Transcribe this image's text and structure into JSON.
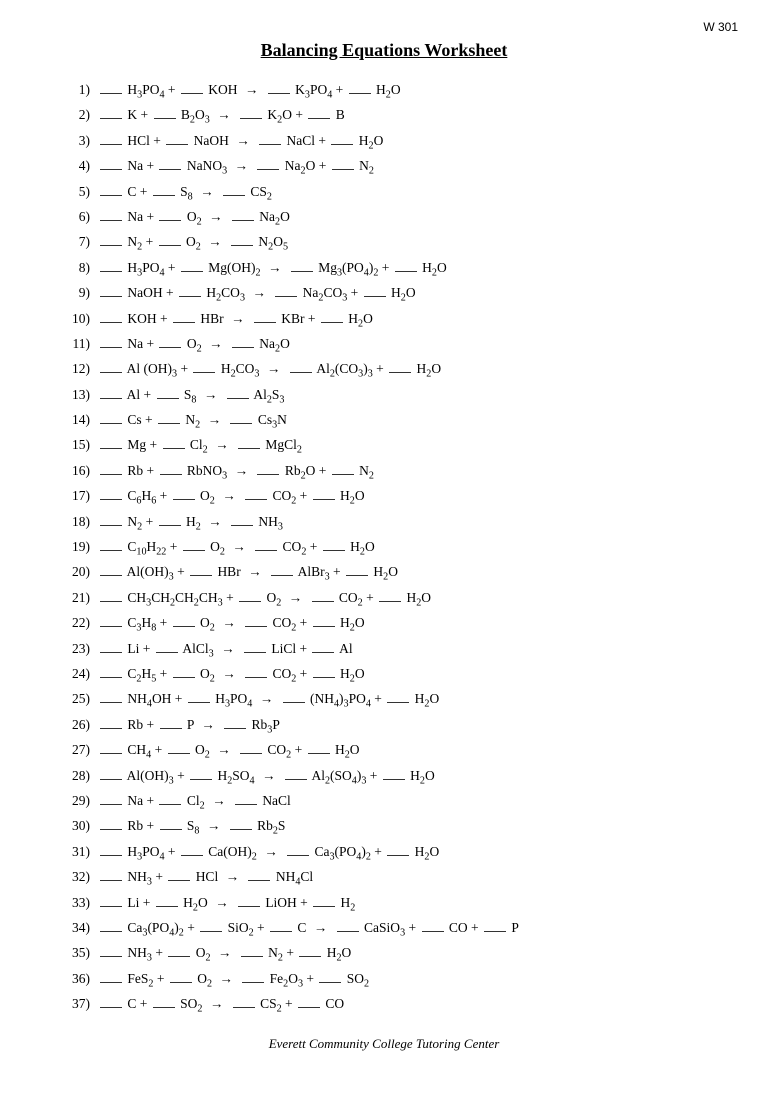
{
  "page": {
    "number": "W 301",
    "title": "Balancing Equations Worksheet",
    "footer": "Everett Community College Tutoring Center"
  }
}
